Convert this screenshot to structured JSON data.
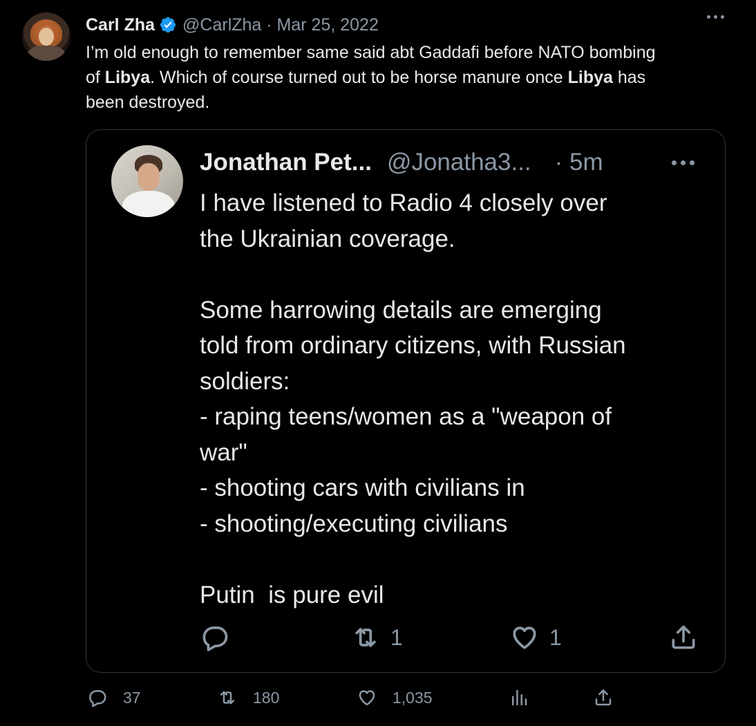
{
  "tweet": {
    "author_name": "Carl Zha",
    "handle_time": "@CarlZha · Mar 25, 2022",
    "text_line1": "I’m old enough to remember same said abt Gaddafi before NATO bombing",
    "text_line2_a": "of ",
    "text_line2_b": "Libya",
    "text_line2_c": ". Which of course turned out to be horse manure once ",
    "text_line2_d": "Libya",
    "text_line2_e": " has",
    "text_line3": "been destroyed.",
    "stats": {
      "replies": "37",
      "retweets": "180",
      "likes": "1,035"
    },
    "icons": [
      "verified-badge-icon",
      "more-icon",
      "reply-icon",
      "retweet-icon",
      "like-icon",
      "analytics-icon",
      "share-icon"
    ],
    "colors": {
      "verified": "#1d9bf0",
      "muted": "#8b98a5",
      "text": "#e7e9ea",
      "background": "#000000"
    }
  },
  "quoted_tweet": {
    "author_name": "Jonathan Pet...",
    "handle": "@Jonatha3...",
    "time": "· 5m",
    "text": "I have listened to Radio 4 closely over\nthe Ukrainian coverage.\n\nSome harrowing details are emerging\ntold from ordinary citizens, with Russian\nsoldiers:\n- raping teens/women as a \"weapon of\nwar\"\n- shooting cars with civilians in\n- shooting/executing civilians\n\nPutin  is pure evil",
    "stats": {
      "retweets": "1",
      "likes": "1"
    }
  }
}
